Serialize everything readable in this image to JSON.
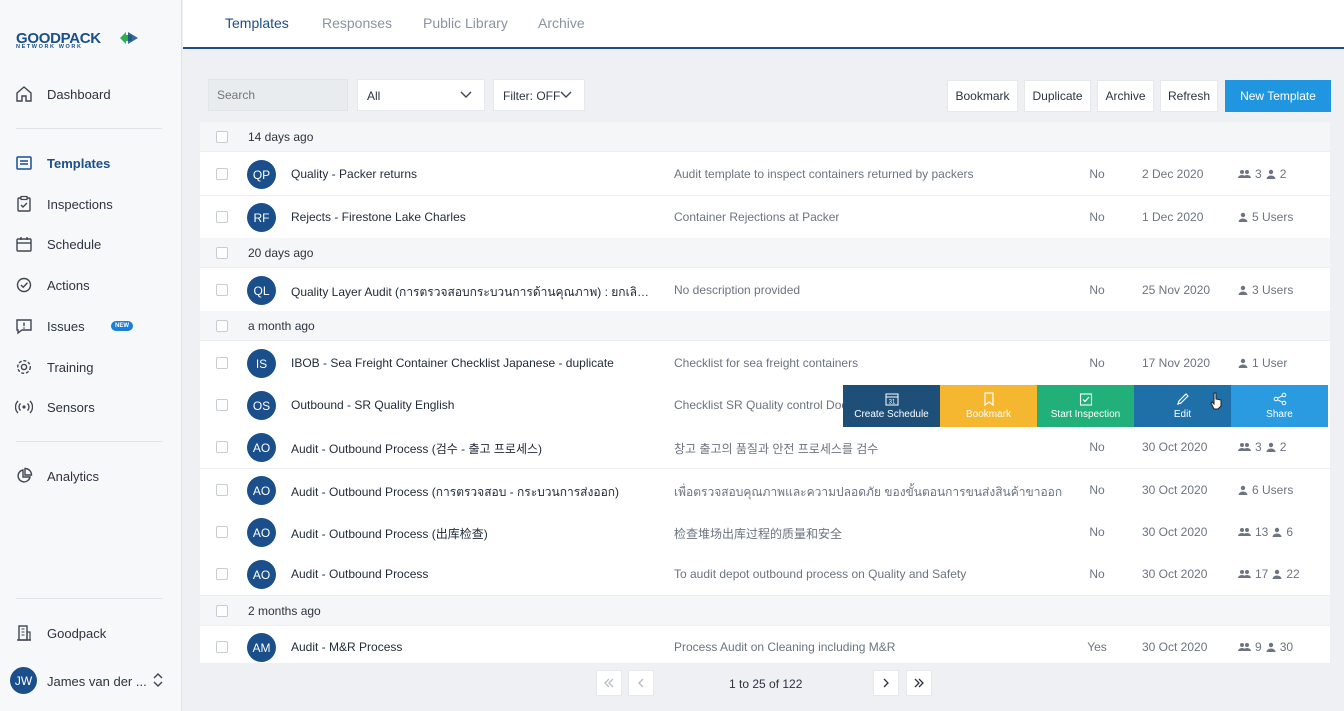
{
  "brand": {
    "name": "GOODPACK",
    "tagline": "NETWORK WORK"
  },
  "sidebar": {
    "items": [
      {
        "label": "Dashboard"
      },
      {
        "label": "Templates"
      },
      {
        "label": "Inspections"
      },
      {
        "label": "Schedule"
      },
      {
        "label": "Actions"
      },
      {
        "label": "Issues",
        "badge": "NEW"
      },
      {
        "label": "Training"
      },
      {
        "label": "Sensors"
      },
      {
        "label": "Analytics"
      },
      {
        "label": "Goodpack"
      }
    ],
    "user": {
      "initials": "JW",
      "name": "James van der ..."
    }
  },
  "tabs": [
    "Templates",
    "Responses",
    "Public Library",
    "Archive"
  ],
  "toolbar": {
    "search_placeholder": "Search",
    "select_value": "All",
    "filter_label": "Filter: OFF",
    "bookmark": "Bookmark",
    "duplicate": "Duplicate",
    "archive": "Archive",
    "refresh": "Refresh",
    "new_template": "New Template"
  },
  "groups": [
    "14 days ago",
    "20 days ago",
    "a month ago",
    "2 months ago"
  ],
  "rows": [
    {
      "initials": "QP",
      "name": "Quality - Packer returns",
      "desc": "Audit template to inspect containers returned by packers",
      "pub": "No",
      "date": "2 Dec 2020",
      "groups": "3",
      "users": "2"
    },
    {
      "initials": "RF",
      "name": "Rejects - Firestone Lake Charles",
      "desc": "Container Rejections at Packer",
      "pub": "No",
      "date": "1 Dec 2020",
      "users_text": "5 Users"
    },
    {
      "initials": "QL",
      "name": "Quality Layer Audit (การตรวจสอบกระบวนการด้านคุณภาพ) : ยกเลิกกา...",
      "desc": "No description provided",
      "pub": "No",
      "date": "25 Nov 2020",
      "users_text": "3 Users"
    },
    {
      "initials": "IS",
      "name": "IBOB - Sea Freight Container Checklist Japanese - duplicate",
      "desc": "Checklist for sea freight containers",
      "pub": "No",
      "date": "17 Nov 2020",
      "users_text": "1 User"
    },
    {
      "initials": "OS",
      "name": "Outbound - SR Quality English",
      "desc": "Checklist SR Quality control Doc"
    },
    {
      "initials": "AO",
      "name": "Audit - Outbound Process (검수 - 출고 프로세스)",
      "desc": "창고 출고의 품질과 안전 프로세스를 검수",
      "pub": "No",
      "date": "30 Oct 2020",
      "groups": "3",
      "users": "2"
    },
    {
      "initials": "AO",
      "name": "Audit - Outbound Process (การตรวจสอบ - กระบวนการส่งออก)",
      "desc": "เพื่อตรวจสอบคุณภาพและความปลอดภัย ของขั้นตอนการขนส่งสินค้าขาออก",
      "pub": "No",
      "date": "30 Oct 2020",
      "users_text": "6 Users"
    },
    {
      "initials": "AO",
      "name": "Audit - Outbound Process (出库检查)",
      "desc": "检查堆场出库过程的质量和安全",
      "pub": "No",
      "date": "30 Oct 2020",
      "groups": "13",
      "users": "6"
    },
    {
      "initials": "AO",
      "name": "Audit - Outbound Process",
      "desc": "To audit depot outbound process on Quality and Safety",
      "pub": "No",
      "date": "30 Oct 2020",
      "groups": "17",
      "users": "22"
    },
    {
      "initials": "AM",
      "name": "Audit - M&R Process",
      "desc": "Process Audit on Cleaning including M&R",
      "pub": "Yes",
      "date": "30 Oct 2020",
      "groups": "9",
      "users": "30"
    }
  ],
  "row_actions": {
    "calendar_day": "31",
    "create_schedule": "Create Schedule",
    "bookmark": "Bookmark",
    "start_inspection": "Start Inspection",
    "edit": "Edit",
    "share": "Share"
  },
  "pagination": {
    "info": "1 to 25 of 122"
  },
  "colors": {
    "primary": "#1a4f8b",
    "accent_blue": "#2196e0",
    "schedule": "#1d4f78",
    "bookmark": "#f6b730",
    "inspection": "#21b07a",
    "edit": "#1f6fa8",
    "share": "#2a9be0"
  }
}
